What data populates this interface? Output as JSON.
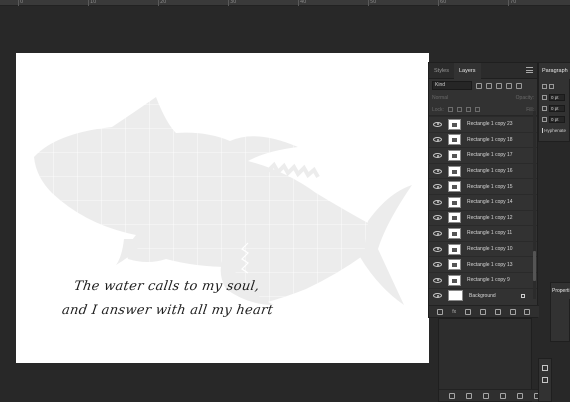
{
  "ruler": {
    "numbers": [
      "0",
      "10",
      "20",
      "30",
      "40",
      "50",
      "60",
      "70"
    ]
  },
  "canvas": {
    "quote_line1": "The water calls to my soul,",
    "quote_line2": "and I answer with all my heart",
    "background": "#ffffff",
    "silhouette_color": "#ebebeb"
  },
  "layers_panel": {
    "tabs": [
      {
        "label": "Styles",
        "active": false
      },
      {
        "label": "Layers",
        "active": true
      }
    ],
    "filter_kind": "Kind",
    "blend_mode": "Normal",
    "opacity_label": "Opacity:",
    "lock_label": "Lock:",
    "fill_label": "Fill:",
    "layers": [
      "Rectangle 1 copy 23",
      "Rectangle 1 copy 18",
      "Rectangle 1 copy 17",
      "Rectangle 1 copy 16",
      "Rectangle 1 copy 15",
      "Rectangle 1 copy 14",
      "Rectangle 1 copy 12",
      "Rectangle 1 copy 11",
      "Rectangle 1 copy 10",
      "Rectangle 1 copy 13",
      "Rectangle 1 copy 9",
      "Background"
    ],
    "footer_fx": "fx"
  },
  "paragraph_panel": {
    "tab": "Paragraph",
    "values": [
      "0 pt",
      "0 pt",
      "0 pt"
    ],
    "hyphenate": "Hyphenate"
  },
  "properties_panel": {
    "tab": "Properti"
  },
  "icons": [
    "eye-icon",
    "lock-icon",
    "search-icon",
    "menu-icon",
    "link-icon",
    "fx-icon",
    "mask-icon",
    "adjustment-icon",
    "folder-icon",
    "new-layer-icon",
    "trash-icon",
    "play-icon"
  ]
}
